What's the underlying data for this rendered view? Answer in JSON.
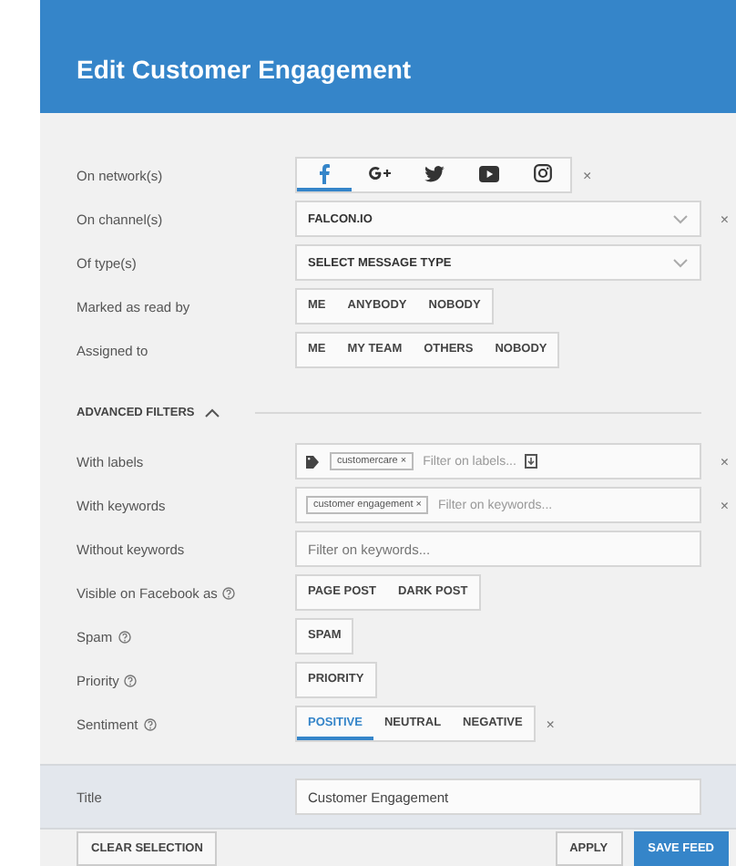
{
  "dialog": {
    "title": "Edit Customer Engagement"
  },
  "filters": [
    {
      "kind": "networks",
      "label": "On network(s)",
      "help": false,
      "clear": "×",
      "networks": [
        {
          "kind": "facebook",
          "selected": true
        },
        {
          "kind": "googleplus",
          "selected": false
        },
        {
          "kind": "twitter",
          "selected": false
        },
        {
          "kind": "youtube",
          "selected": false
        },
        {
          "kind": "instagram",
          "selected": false
        }
      ]
    },
    {
      "kind": "select",
      "label": "On channel(s)",
      "help": false,
      "clear": "×",
      "value": "FALCON.IO"
    },
    {
      "kind": "select",
      "label": "Of type(s)",
      "help": false,
      "value": "SELECT MESSAGE TYPE"
    },
    {
      "kind": "segmented",
      "label": "Marked as read by",
      "help": false,
      "options": [
        {
          "label": "ME",
          "selected": false
        },
        {
          "label": "ANYBODY",
          "selected": false
        },
        {
          "label": "NOBODY",
          "selected": false
        }
      ]
    },
    {
      "kind": "segmented",
      "label": "Assigned to",
      "help": false,
      "options": [
        {
          "label": "ME",
          "selected": false
        },
        {
          "label": "MY TEAM",
          "selected": false
        },
        {
          "label": "OTHERS",
          "selected": false
        },
        {
          "label": "NOBODY",
          "selected": false
        }
      ]
    }
  ],
  "advanced": {
    "heading": "ADVANCED FILTERS",
    "expanded": true,
    "filters": [
      {
        "kind": "labels",
        "label": "With labels",
        "help": false,
        "clear": "×",
        "tags": [
          "customercare ×"
        ],
        "placeholder": "Filter on labels..."
      },
      {
        "kind": "keywords",
        "label": "With keywords",
        "help": false,
        "clear": "×",
        "tags": [
          "customer engagement ×"
        ],
        "placeholder": "Filter on keywords..."
      },
      {
        "kind": "input",
        "label": "Without keywords",
        "help": false,
        "placeholder": "Filter on keywords..."
      },
      {
        "kind": "segmented",
        "label": "Visible on Facebook as",
        "help": true,
        "options": [
          {
            "label": "PAGE POST",
            "selected": false
          },
          {
            "label": "DARK POST",
            "selected": false
          }
        ]
      },
      {
        "kind": "segmented",
        "label": "Spam",
        "help": true,
        "options": [
          {
            "label": "SPAM",
            "selected": false
          }
        ]
      },
      {
        "kind": "segmented",
        "label": "Priority",
        "help": true,
        "options": [
          {
            "label": "PRIORITY",
            "selected": false
          }
        ]
      },
      {
        "kind": "segmented",
        "label": "Sentiment",
        "help": true,
        "clear": "×",
        "options": [
          {
            "label": "POSITIVE",
            "selected": true
          },
          {
            "label": "NEUTRAL",
            "selected": false
          },
          {
            "label": "NEGATIVE",
            "selected": false
          }
        ]
      }
    ]
  },
  "title_field": {
    "label": "Title",
    "value": "Customer Engagement"
  },
  "footer": {
    "clear": "CLEAR SELECTION",
    "apply": "APPLY",
    "save": "SAVE FEED"
  }
}
